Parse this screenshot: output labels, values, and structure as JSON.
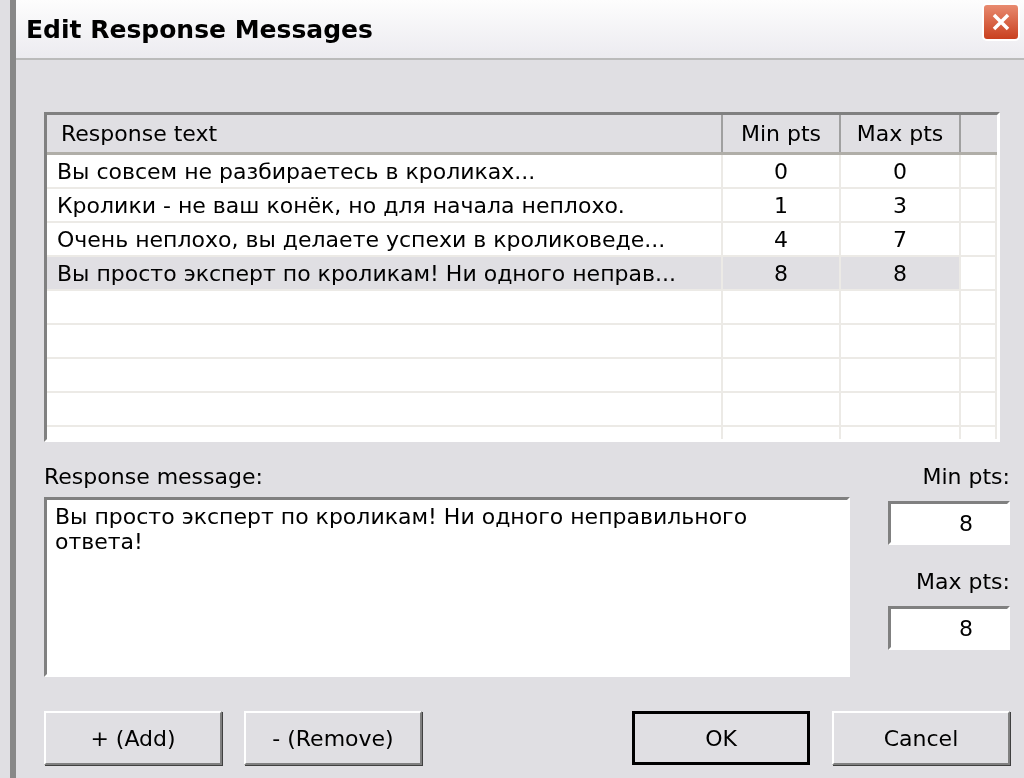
{
  "window": {
    "title": "Edit Response Messages"
  },
  "table": {
    "columns": [
      "Response text",
      "Min pts",
      "Max pts"
    ],
    "rows": [
      {
        "text": "Вы совсем не разбираетесь в кроликах...",
        "min": "0",
        "max": "0",
        "selected": false
      },
      {
        "text": "Кролики - не ваш конёк, но для начала неплохо.",
        "min": "1",
        "max": "3",
        "selected": false
      },
      {
        "text": "Очень неплохо, вы делаете успехи в кроликоведе...",
        "min": "4",
        "max": "7",
        "selected": false
      },
      {
        "text": "Вы просто эксперт по кроликам! Ни одного неправ...",
        "min": "8",
        "max": "8",
        "selected": true
      }
    ]
  },
  "message": {
    "label": "Response message:",
    "value": "Вы просто эксперт по кроликам! Ни одного неправильного ответа!"
  },
  "min_pts": {
    "label": "Min pts:",
    "value": "8"
  },
  "max_pts": {
    "label": "Max pts:",
    "value": "8"
  },
  "buttons": [
    {
      "label": "+ (Add)",
      "kind": "normal"
    },
    {
      "label": "- (Remove)",
      "kind": "normal"
    },
    {
      "label": "OK",
      "kind": "default"
    },
    {
      "label": "Cancel",
      "kind": "normal"
    }
  ]
}
